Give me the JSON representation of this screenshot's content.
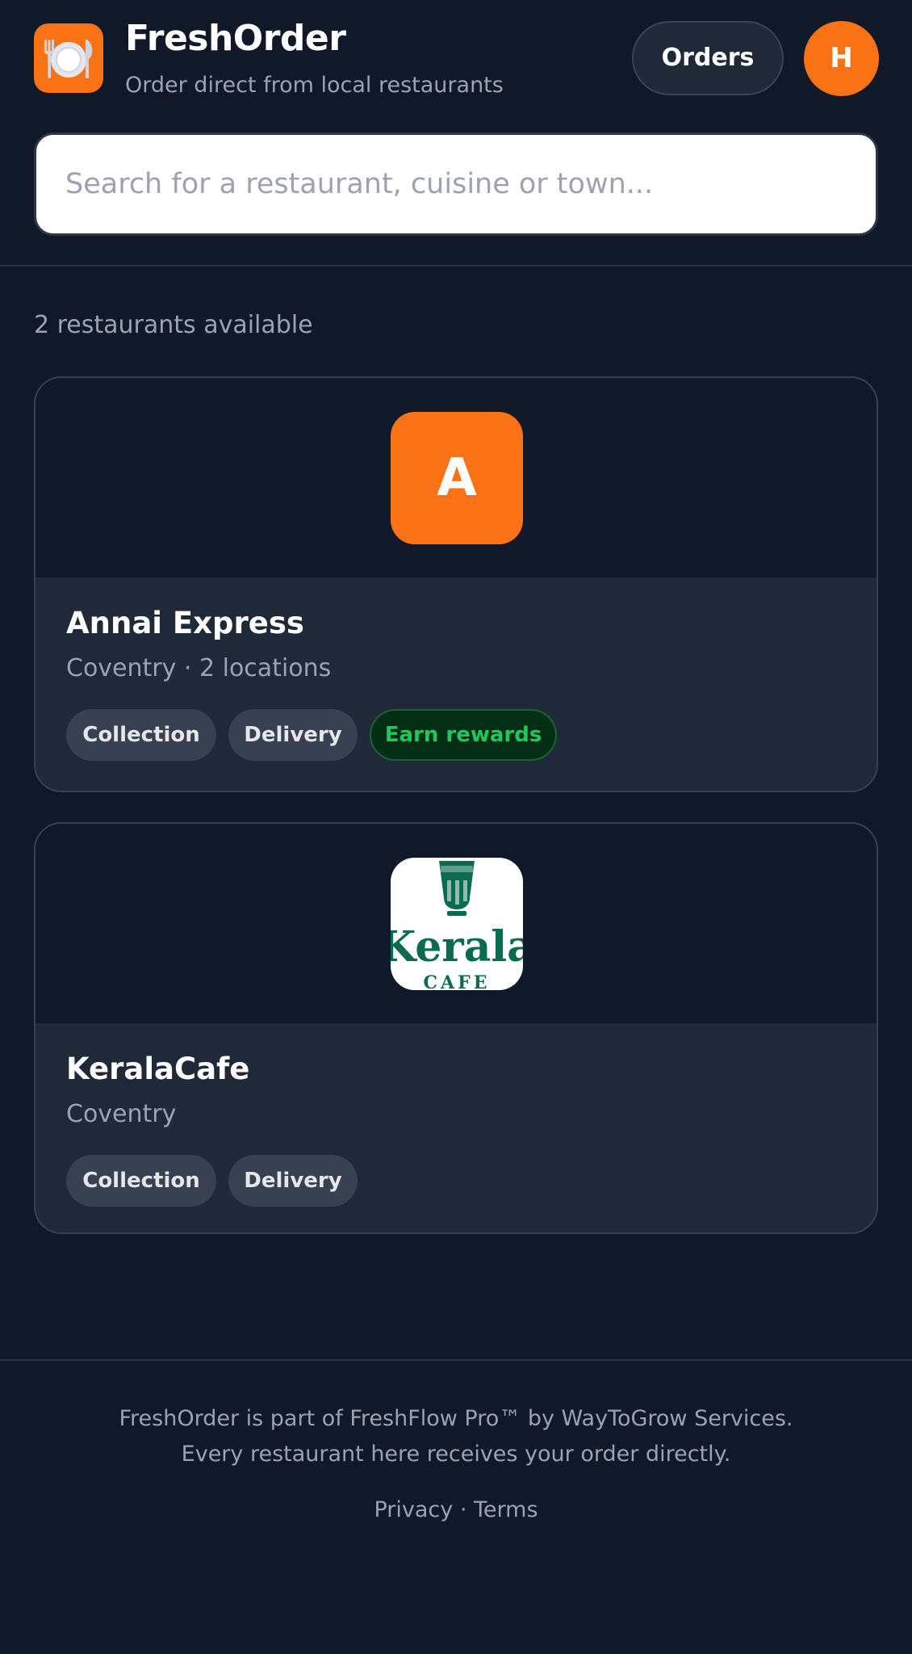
{
  "header": {
    "app_name": "FreshOrder",
    "tagline": "Order direct from local restaurants",
    "orders_label": "Orders",
    "avatar_initial": "H",
    "logo_icon": "plate-cutlery-icon"
  },
  "search": {
    "placeholder": "Search for a restaurant, cuisine or town...",
    "value": ""
  },
  "results": {
    "count_text": "2 restaurants available"
  },
  "restaurants": [
    {
      "name": "Annai Express",
      "location": "Coventry · 2 locations",
      "logo_initial": "A",
      "tags": [
        "Collection",
        "Delivery",
        "Earn rewards"
      ]
    },
    {
      "name": "KeralaCafe",
      "location": "Coventry",
      "logo_text": "Kerala",
      "logo_subtext": "CAFE",
      "tags": [
        "Collection",
        "Delivery"
      ]
    }
  ],
  "footer": {
    "line1": "FreshOrder is part of FreshFlow Pro™ by WayToGrow Services.",
    "line2": "Every restaurant here receives your order directly.",
    "privacy": "Privacy",
    "separator": "·",
    "terms": "Terms"
  },
  "colors": {
    "background": "#111827",
    "card": "#1f2937",
    "accent": "#f97316",
    "rewards_green": "#22c55e",
    "kerala_green": "#0b6b4f"
  }
}
